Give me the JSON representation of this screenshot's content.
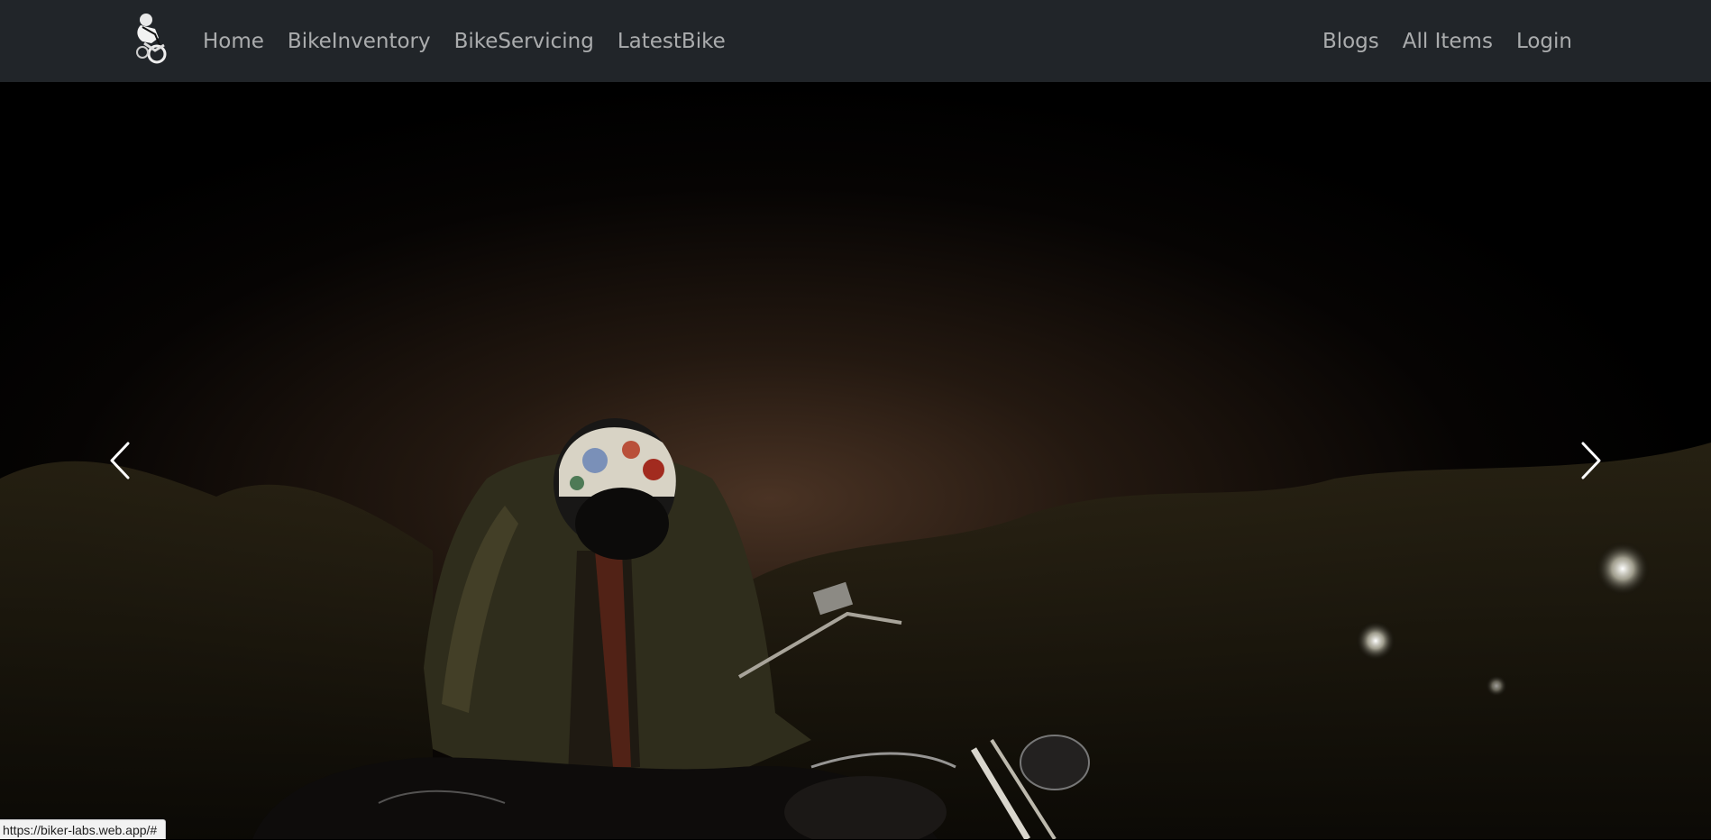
{
  "navbar": {
    "brand_icon": "motorcycle-rider-logo",
    "left_links": [
      {
        "label": "Home"
      },
      {
        "label": "BikeInventory"
      },
      {
        "label": "BikeServicing"
      },
      {
        "label": "LatestBike"
      }
    ],
    "right_links": [
      {
        "label": "Blogs"
      },
      {
        "label": "All Items"
      },
      {
        "label": "Login"
      }
    ],
    "background": "#212529"
  },
  "carousel": {
    "prev_icon": "chevron-left-icon",
    "next_icon": "chevron-right-icon"
  },
  "status_bar": {
    "url": "https://biker-labs.web.app/#"
  }
}
